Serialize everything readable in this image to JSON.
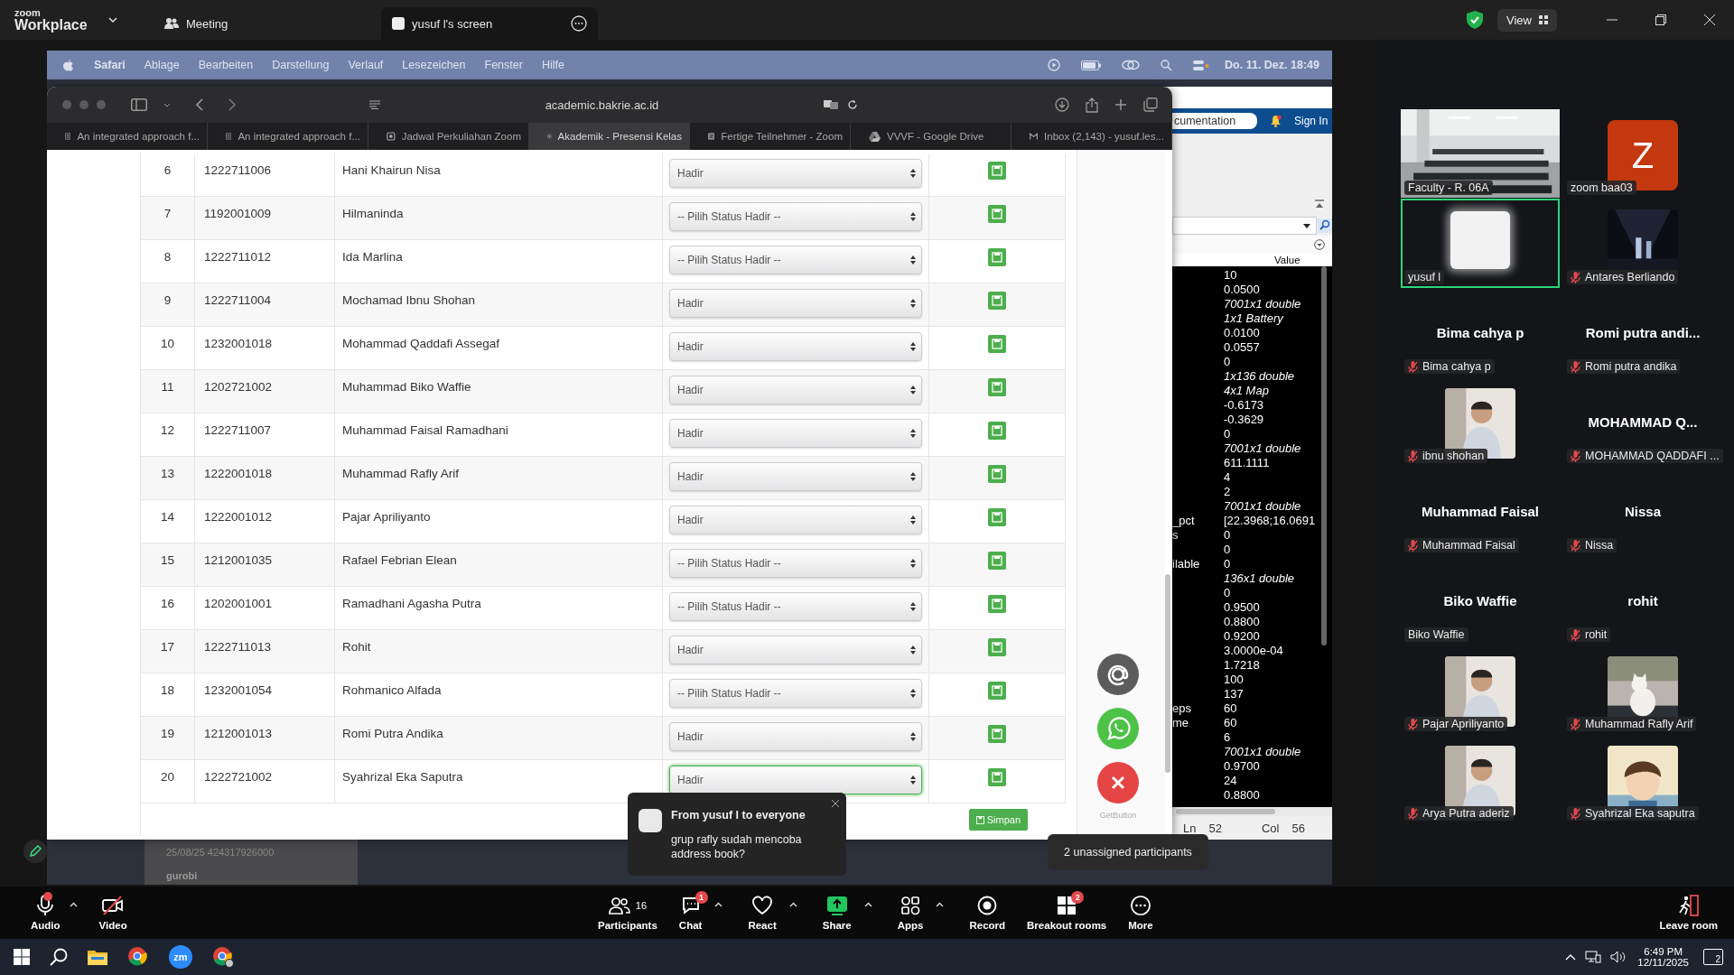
{
  "app": {
    "logo_top": "zoom",
    "logo_bottom": "Workplace"
  },
  "tabs": [
    {
      "label": "Meeting",
      "selected": false
    },
    {
      "label": "yusuf l's screen",
      "selected": true
    }
  ],
  "view_button": "View",
  "mac_menu": {
    "app_name": "Safari",
    "items": [
      "Ablage",
      "Bearbeiten",
      "Darstellung",
      "Verlauf",
      "Lesezeichen",
      "Fenster",
      "Hilfe"
    ],
    "clock": "Do. 11. Dez.  18:49"
  },
  "safari": {
    "address": "academic.bakrie.ac.id",
    "tabs": [
      {
        "label": "An integrated approach f...",
        "selected": false,
        "kind": "page"
      },
      {
        "label": "An integrated approach f...",
        "selected": false,
        "kind": "page"
      },
      {
        "label": "Jadwal Perkuliahan Zoom",
        "selected": false,
        "kind": "site"
      },
      {
        "label": "Akademik - Presensi Kelas",
        "selected": true,
        "kind": "site"
      },
      {
        "label": "Fertige Teilnehmer - Zoom",
        "selected": false,
        "kind": "square"
      },
      {
        "label": "VVVF - Google Drive",
        "selected": false,
        "kind": "drive"
      },
      {
        "label": "Inbox (2,143) - yusuf.les...",
        "selected": false,
        "kind": "mail"
      }
    ]
  },
  "attendance": {
    "rows": [
      {
        "no": "6",
        "nim": "1222711006",
        "name": "Hani Khairun Nisa",
        "status": "Hadir",
        "focused": false
      },
      {
        "no": "7",
        "nim": "1192001009",
        "name": "Hilmaninda",
        "status": "-- Pilih Status Hadir --",
        "focused": false
      },
      {
        "no": "8",
        "nim": "1222711012",
        "name": "Ida Marlina",
        "status": "-- Pilih Status Hadir --",
        "focused": false
      },
      {
        "no": "9",
        "nim": "1222711004",
        "name": "Mochamad Ibnu Shohan",
        "status": "Hadir",
        "focused": false
      },
      {
        "no": "10",
        "nim": "1232001018",
        "name": "Mohammad Qaddafi Assegaf",
        "status": "Hadir",
        "focused": false
      },
      {
        "no": "11",
        "nim": "1202721002",
        "name": "Muhammad Biko Waffie",
        "status": "Hadir",
        "focused": false
      },
      {
        "no": "12",
        "nim": "1222711007",
        "name": "Muhammad Faisal Ramadhani",
        "status": "Hadir",
        "focused": false
      },
      {
        "no": "13",
        "nim": "1222001018",
        "name": "Muhammad Rafly Arif",
        "status": "Hadir",
        "focused": false
      },
      {
        "no": "14",
        "nim": "1222001012",
        "name": "Pajar Apriliyanto",
        "status": "Hadir",
        "focused": false
      },
      {
        "no": "15",
        "nim": "1212001035",
        "name": "Rafael Febrian Elean",
        "status": "-- Pilih Status Hadir --",
        "focused": false
      },
      {
        "no": "16",
        "nim": "1202001001",
        "name": "Ramadhani Agasha Putra",
        "status": "-- Pilih Status Hadir --",
        "focused": false
      },
      {
        "no": "17",
        "nim": "1222711013",
        "name": "Rohit",
        "status": "Hadir",
        "focused": false
      },
      {
        "no": "18",
        "nim": "1232001054",
        "name": "Rohmanico Alfada",
        "status": "-- Pilih Status Hadir --",
        "focused": false
      },
      {
        "no": "19",
        "nim": "1212001013",
        "name": "Romi Putra Andika",
        "status": "Hadir",
        "focused": false
      },
      {
        "no": "20",
        "nim": "1222721002",
        "name": "Syahrizal Eka Saputra",
        "status": "Hadir",
        "focused": true
      }
    ],
    "save_button": "Simpan"
  },
  "floating_buttons": [
    {
      "kind": "email"
    },
    {
      "kind": "whatsapp"
    },
    {
      "kind": "close"
    }
  ],
  "getbutton_label": "GetButton",
  "matlab": {
    "search_value": "cumentation",
    "sign_in": "Sign In",
    "value_header": "Value",
    "rows": [
      {
        "value": "10",
        "kind": "plain"
      },
      {
        "value": "0.0500",
        "kind": "plain"
      },
      {
        "value": "7001x1 double",
        "kind": "size"
      },
      {
        "value": "1x1 Battery",
        "kind": "size"
      },
      {
        "value": "0.0100",
        "kind": "plain"
      },
      {
        "value": "0.0557",
        "kind": "plain"
      },
      {
        "value": "0",
        "kind": "plain"
      },
      {
        "value": "1x136 double",
        "kind": "size"
      },
      {
        "value": "4x1 Map",
        "kind": "size"
      },
      {
        "value": "-0.6173",
        "kind": "plain"
      },
      {
        "value": "-0.3629",
        "kind": "plain"
      },
      {
        "value": "0",
        "kind": "plain"
      },
      {
        "value": "7001x1 double",
        "kind": "size"
      },
      {
        "value": "611.1111",
        "kind": "plain"
      },
      {
        "value": "4",
        "kind": "plain"
      },
      {
        "value": "2",
        "kind": "plain"
      },
      {
        "value": "7001x1 double",
        "kind": "size"
      },
      {
        "name": "_pct",
        "value": "[22.3968;16.0691",
        "kind": "plain"
      },
      {
        "name": "s",
        "value": "0",
        "kind": "plain"
      },
      {
        "value": "0",
        "kind": "plain"
      },
      {
        "name": "ilable",
        "value": "0",
        "kind": "plain"
      },
      {
        "value": "136x1 double",
        "kind": "size"
      },
      {
        "value": "0",
        "kind": "plain"
      },
      {
        "value": "0.9500",
        "kind": "plain"
      },
      {
        "value": "0.8800",
        "kind": "plain"
      },
      {
        "value": "0.9200",
        "kind": "plain"
      },
      {
        "value": "3.0000e-04",
        "kind": "plain"
      },
      {
        "value": "1.7218",
        "kind": "plain"
      },
      {
        "value": "100",
        "kind": "plain"
      },
      {
        "value": "137",
        "kind": "plain"
      },
      {
        "name": "eps",
        "value": "60",
        "kind": "plain"
      },
      {
        "name": "me",
        "value": "60",
        "kind": "plain"
      },
      {
        "value": "6",
        "kind": "plain"
      },
      {
        "value": "7001x1 double",
        "kind": "size"
      },
      {
        "value": "0.9700",
        "kind": "plain"
      },
      {
        "value": "24",
        "kind": "plain"
      },
      {
        "value": "0.8800",
        "kind": "plain"
      }
    ],
    "status": {
      "ln_label": "Ln",
      "ln": "52",
      "col_label": "Col",
      "col": "56"
    }
  },
  "desktop_behind": {
    "line_1": "25/08/25  424317926000",
    "line_2": "gurobi"
  },
  "chat_popup": {
    "title": "From yusuf l to everyone",
    "message": "grup rafly sudah mencoba address book?"
  },
  "tooltip": "2 unassigned participants",
  "participants": [
    {
      "name": "Faculty - R. 06A",
      "kind": "camera",
      "muted": false,
      "active_speaker": false
    },
    {
      "name": "zoom baa03",
      "kind": "avatar",
      "avatar_letter": "Z",
      "muted": false,
      "active_speaker": false
    },
    {
      "name": "yusuf l",
      "kind": "blank",
      "muted": false,
      "active_speaker": true
    },
    {
      "name": "Antares Berliando",
      "muted": true,
      "active_speaker": false
    },
    {
      "name": "Bima cahya p",
      "kind": "name",
      "display_name": "Bima cahya p",
      "muted": true,
      "active_speaker": false
    },
    {
      "name": "Romi putra andika",
      "kind": "name",
      "display_name": "Romi putra andi...",
      "muted": true,
      "active_speaker": false
    },
    {
      "name": "ibnu shohan",
      "muted": true,
      "active_speaker": false
    },
    {
      "name": "MOHAMMAD QADDAFI ...",
      "kind": "name",
      "display_name": "MOHAMMAD Q...",
      "muted": true,
      "active_speaker": false
    },
    {
      "name": "Muhammad Faisal",
      "kind": "name",
      "display_name": "Muhammad Faisal",
      "muted": true,
      "active_speaker": false
    },
    {
      "name": "Nissa",
      "kind": "name",
      "display_name": "Nissa",
      "muted": true,
      "active_speaker": false
    },
    {
      "name": "Biko Waffie",
      "kind": "name",
      "display_name": "Biko Waffie",
      "muted": false,
      "active_speaker": false
    },
    {
      "name": "rohit",
      "kind": "name",
      "display_name": "rohit",
      "muted": true,
      "active_speaker": false
    },
    {
      "name": "Pajar Apriliyanto",
      "muted": true,
      "active_speaker": false
    },
    {
      "name": "Muhammad Rafly Arif",
      "muted": true,
      "active_speaker": false
    },
    {
      "name": "Arya Putra aderiz",
      "muted": true,
      "active_speaker": false
    },
    {
      "name": "Syahrizal Eka saputra",
      "muted": true,
      "active_speaker": false
    }
  ],
  "toolbar": {
    "left": [
      {
        "kind": "audio",
        "label": "Audio",
        "caret": true,
        "alert": true
      },
      {
        "kind": "video",
        "label": "Video",
        "caret": false,
        "alert": false
      }
    ],
    "center": [
      {
        "kind": "participants",
        "label": "Participants",
        "count": "16",
        "caret": false
      },
      {
        "kind": "chat",
        "label": "Chat",
        "badge": "1",
        "caret": true
      },
      {
        "kind": "react",
        "label": "React",
        "caret": true
      },
      {
        "kind": "share",
        "label": "Share",
        "caret": true
      },
      {
        "kind": "apps",
        "label": "Apps",
        "caret": true
      },
      {
        "kind": "record",
        "label": "Record",
        "caret": false
      },
      {
        "kind": "breakout",
        "label": "Breakout rooms",
        "badge": "2",
        "caret": false
      },
      {
        "kind": "more",
        "label": "More",
        "caret": false
      }
    ],
    "leave": "Leave room"
  },
  "taskbar": {
    "apps": [
      {
        "kind": "start"
      },
      {
        "kind": "search"
      },
      {
        "kind": "explorer"
      },
      {
        "kind": "chrome"
      },
      {
        "kind": "zoom",
        "label": "zm"
      },
      {
        "kind": "chrome_profile"
      }
    ],
    "time": "6:49 PM",
    "date": "12/11/2025",
    "notifications": "2"
  }
}
